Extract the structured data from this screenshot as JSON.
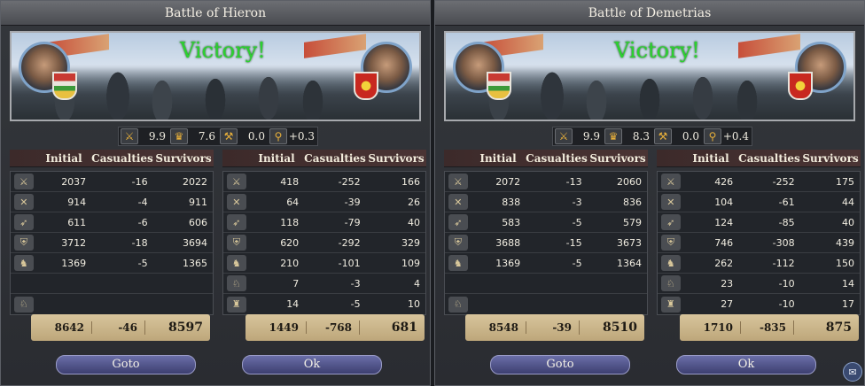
{
  "panels": [
    {
      "title": "Battle of Hieron",
      "result": "Victory!",
      "modifiers": [
        {
          "icon": "crossed-swords-icon",
          "value": "9.9"
        },
        {
          "icon": "crown-icon",
          "value": "7.6"
        },
        {
          "icon": "hammer-icon",
          "value": "0.0"
        },
        {
          "icon": "magnifier-icon",
          "value": "+0.3"
        }
      ],
      "headers": {
        "initial": "Initial",
        "casualties": "Casualties",
        "survivors": "Survivors"
      },
      "side_a": {
        "rows": [
          {
            "unit": "light-infantry-icon",
            "initial": "2037",
            "casualties": "-16",
            "survivors": "2022"
          },
          {
            "unit": "heavy-infantry-icon",
            "initial": "914",
            "casualties": "-4",
            "survivors": "911"
          },
          {
            "unit": "archers-icon",
            "initial": "611",
            "casualties": "-6",
            "survivors": "606"
          },
          {
            "unit": "pikemen-icon",
            "initial": "3712",
            "casualties": "-18",
            "survivors": "3694"
          },
          {
            "unit": "light-cavalry-icon",
            "initial": "1369",
            "casualties": "-5",
            "survivors": "1365"
          },
          {
            "unit": "",
            "initial": "",
            "casualties": "",
            "survivors": ""
          },
          {
            "unit": "horse-archers-icon",
            "initial": "",
            "casualties": "",
            "survivors": ""
          }
        ],
        "totals": {
          "initial": "8642",
          "casualties": "-46",
          "survivors": "8597"
        }
      },
      "side_b": {
        "rows": [
          {
            "unit": "light-infantry-icon",
            "initial": "418",
            "casualties": "-252",
            "survivors": "166"
          },
          {
            "unit": "heavy-infantry-icon",
            "initial": "64",
            "casualties": "-39",
            "survivors": "26"
          },
          {
            "unit": "archers-icon",
            "initial": "118",
            "casualties": "-79",
            "survivors": "40"
          },
          {
            "unit": "pikemen-icon",
            "initial": "620",
            "casualties": "-292",
            "survivors": "329"
          },
          {
            "unit": "light-cavalry-icon",
            "initial": "210",
            "casualties": "-101",
            "survivors": "109"
          },
          {
            "unit": "horse-archers-icon",
            "initial": "7",
            "casualties": "-3",
            "survivors": "4"
          },
          {
            "unit": "knights-icon",
            "initial": "14",
            "casualties": "-5",
            "survivors": "10"
          }
        ],
        "totals": {
          "initial": "1449",
          "casualties": "-768",
          "survivors": "681"
        }
      },
      "buttons": {
        "goto": "Goto",
        "ok": "Ok"
      }
    },
    {
      "title": "Battle of Demetrias",
      "result": "Victory!",
      "modifiers": [
        {
          "icon": "crossed-swords-icon",
          "value": "9.9"
        },
        {
          "icon": "crown-icon",
          "value": "8.3"
        },
        {
          "icon": "hammer-icon",
          "value": "0.0"
        },
        {
          "icon": "magnifier-icon",
          "value": "+0.4"
        }
      ],
      "headers": {
        "initial": "Initial",
        "casualties": "Casualties",
        "survivors": "Survivors"
      },
      "side_a": {
        "rows": [
          {
            "unit": "light-infantry-icon",
            "initial": "2072",
            "casualties": "-13",
            "survivors": "2060"
          },
          {
            "unit": "heavy-infantry-icon",
            "initial": "838",
            "casualties": "-3",
            "survivors": "836"
          },
          {
            "unit": "archers-icon",
            "initial": "583",
            "casualties": "-5",
            "survivors": "579"
          },
          {
            "unit": "pikemen-icon",
            "initial": "3688",
            "casualties": "-15",
            "survivors": "3673"
          },
          {
            "unit": "light-cavalry-icon",
            "initial": "1369",
            "casualties": "-5",
            "survivors": "1364"
          },
          {
            "unit": "",
            "initial": "",
            "casualties": "",
            "survivors": ""
          },
          {
            "unit": "horse-archers-icon",
            "initial": "",
            "casualties": "",
            "survivors": ""
          }
        ],
        "totals": {
          "initial": "8548",
          "casualties": "-39",
          "survivors": "8510"
        }
      },
      "side_b": {
        "rows": [
          {
            "unit": "light-infantry-icon",
            "initial": "426",
            "casualties": "-252",
            "survivors": "175"
          },
          {
            "unit": "heavy-infantry-icon",
            "initial": "104",
            "casualties": "-61",
            "survivors": "44"
          },
          {
            "unit": "archers-icon",
            "initial": "124",
            "casualties": "-85",
            "survivors": "40"
          },
          {
            "unit": "pikemen-icon",
            "initial": "746",
            "casualties": "-308",
            "survivors": "439"
          },
          {
            "unit": "light-cavalry-icon",
            "initial": "262",
            "casualties": "-112",
            "survivors": "150"
          },
          {
            "unit": "horse-archers-icon",
            "initial": "23",
            "casualties": "-10",
            "survivors": "14"
          },
          {
            "unit": "knights-icon",
            "initial": "27",
            "casualties": "-10",
            "survivors": "17"
          }
        ],
        "totals": {
          "initial": "1710",
          "casualties": "-835",
          "survivors": "875"
        }
      },
      "buttons": {
        "goto": "Goto",
        "ok": "Ok"
      }
    }
  ],
  "colors": {
    "victory": "#2bd12f",
    "button": "#4a4d85",
    "totals_bg": "#cbb78b"
  }
}
